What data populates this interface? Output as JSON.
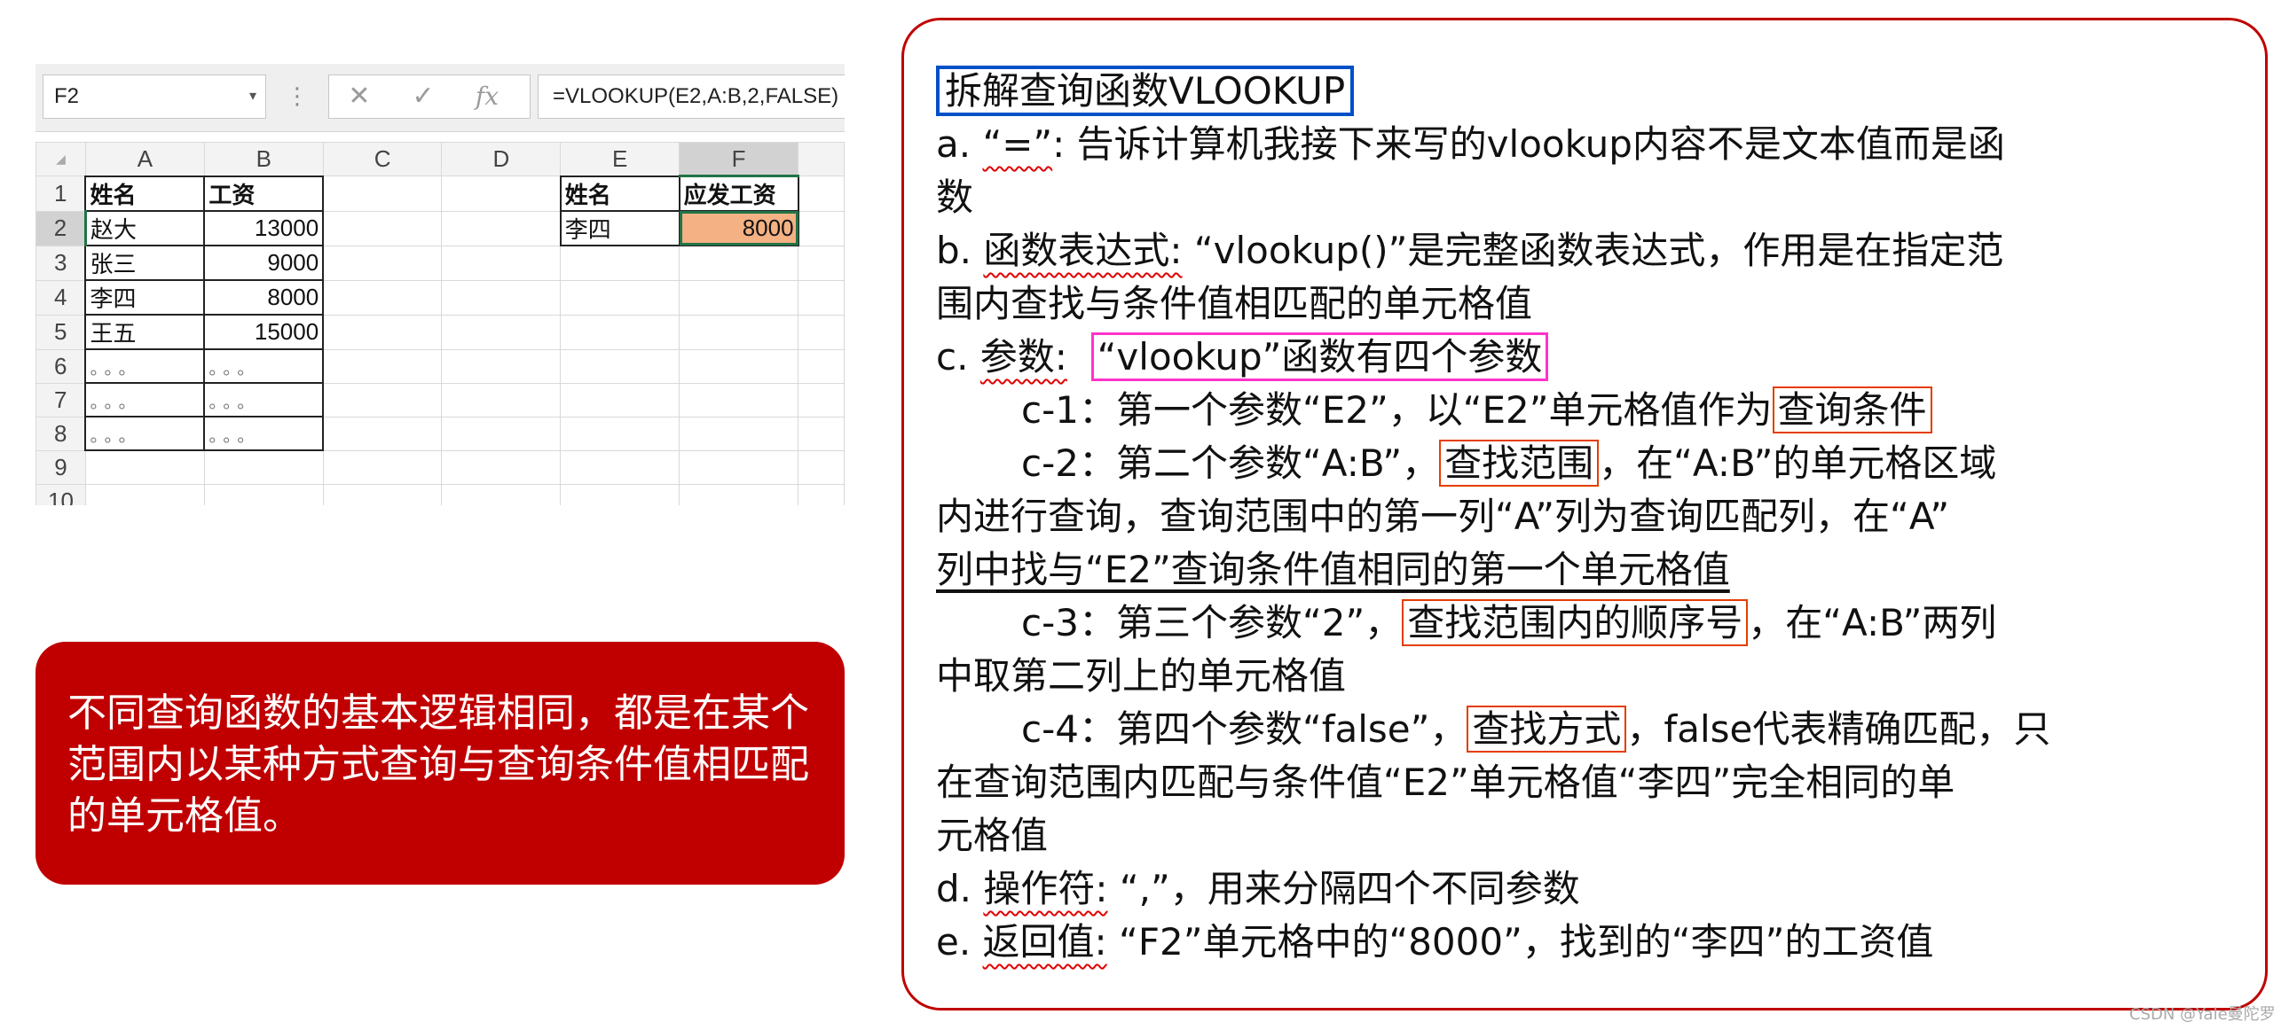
{
  "excel": {
    "name_box": "F2",
    "formula": "=VLOOKUP(E2,A:B,2,FALSE)",
    "formula_buttons": {
      "cancel": "✕",
      "enter": "✓",
      "fx": "fx"
    },
    "columns": [
      "A",
      "B",
      "C",
      "D",
      "E",
      "F"
    ],
    "row_numbers": [
      "1",
      "2",
      "3",
      "4",
      "5",
      "6",
      "7",
      "8",
      "9",
      "10"
    ],
    "table": {
      "headers": [
        "姓名",
        "工资"
      ],
      "rows": [
        [
          "赵大",
          "13000"
        ],
        [
          "张三",
          "9000"
        ],
        [
          "李四",
          "8000"
        ],
        [
          "王五",
          "15000"
        ],
        [
          "。。。",
          "。。。"
        ],
        [
          "。。。",
          "。。。"
        ],
        [
          "。。。",
          "。。。"
        ]
      ]
    },
    "lookup": {
      "headers": [
        "姓名",
        "应发工资"
      ],
      "name": "李四",
      "value": "8000"
    }
  },
  "red_box_text": "不同查询函数的基本逻辑相同，都是在某个范围内以某种方式查询与查询条件值相匹配的单元格值。",
  "explanation": {
    "title": "拆解查询函数VLOOKUP",
    "a_prefix": "a. ",
    "a_term": "“=”",
    "a_text": ": 告诉计算机我接下来写的vlookup内容不是文本值而是函",
    "a_text2": "数",
    "b_prefix": "b. ",
    "b_term": "函数表达式:",
    "b_text": " “vlookup()”是完整函数表达式，作用是在指定范",
    "b_text2": "围内查找与条件值相匹配的单元格值",
    "c_prefix": "c. ",
    "c_term": "参数:",
    "c_box": "“vlookup”函数有四个参数",
    "c1_pre": "c-1：第一个参数“E2”，以“E2”单元格值作为",
    "c1_box": "查询条件",
    "c2_pre": "c-2：第二个参数“A:B”，",
    "c2_box": "查找范围",
    "c2_post": "，在“A:B”的单元格区域",
    "c2_l2": "内进行查询，查询范围中的第一列“A”列为查询匹配列，在“A”",
    "c2_l3": "列中找与“E2”查询条件值相同的第一个单元格值",
    "c3_pre": "c-3：第三个参数“2”，",
    "c3_box": "查找范围内的顺序号",
    "c3_post": "，在“A:B”两列",
    "c3_l2": "中取第二列上的单元格值",
    "c4_pre": "c-4：第四个参数“false”，",
    "c4_box": "查找方式",
    "c4_post": "，false代表精确匹配，只",
    "c4_l2": "在查询范围内匹配与条件值“E2”单元格值“李四”完全相同的单",
    "c4_l3": "元格值",
    "d_prefix": "d. ",
    "d_term": "操作符:",
    "d_text": " “,”，用来分隔四个不同参数",
    "e_prefix": "e. ",
    "e_term": "返回值:",
    "e_text": " “F2”单元格中的“8000”，找到的“李四”的工资值"
  },
  "watermark": "CSDN @Yale曼陀罗"
}
